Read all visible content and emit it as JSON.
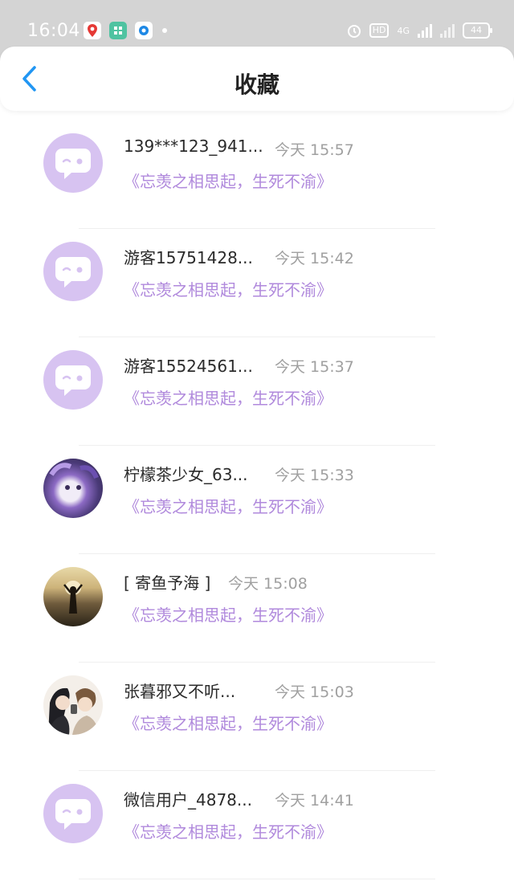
{
  "status_bar": {
    "time": "16:04",
    "hd": "HD",
    "network": "4G",
    "battery": "44",
    "colors": {
      "bg": "#d4d4d4"
    }
  },
  "header": {
    "title": "收藏",
    "back_icon": "chevron-left-icon",
    "back_color": "#2196f3"
  },
  "favorites": [
    {
      "user": "139***123_941...",
      "time": "今天 15:57",
      "title": "《忘羡之相思起，生死不渝》",
      "avatar": "default"
    },
    {
      "user": "游客15751428...",
      "time": "今天 15:42",
      "title": "《忘羡之相思起，生死不渝》",
      "avatar": "default"
    },
    {
      "user": "游客15524561...",
      "time": "今天 15:37",
      "title": "《忘羡之相思起，生死不渝》",
      "avatar": "default"
    },
    {
      "user": "柠檬茶少女_63...",
      "time": "今天 15:33",
      "title": "《忘羡之相思起，生死不渝》",
      "avatar": "photo-purple"
    },
    {
      "user": "[ 寄鱼予海 ]",
      "time": "今天 15:08",
      "title": "《忘羡之相思起，生死不渝》",
      "avatar": "photo-sunset"
    },
    {
      "user": "张暮邪又不听...",
      "time": "今天 15:03",
      "title": "《忘羡之相思起，生死不渝》",
      "avatar": "photo-couple"
    },
    {
      "user": "微信用户_4878...",
      "time": "今天 14:41",
      "title": "《忘羡之相思起，生死不渝》",
      "avatar": "default"
    }
  ],
  "colors": {
    "accent_text": "#b089dc",
    "avatar_default": "#d7c3f1"
  }
}
